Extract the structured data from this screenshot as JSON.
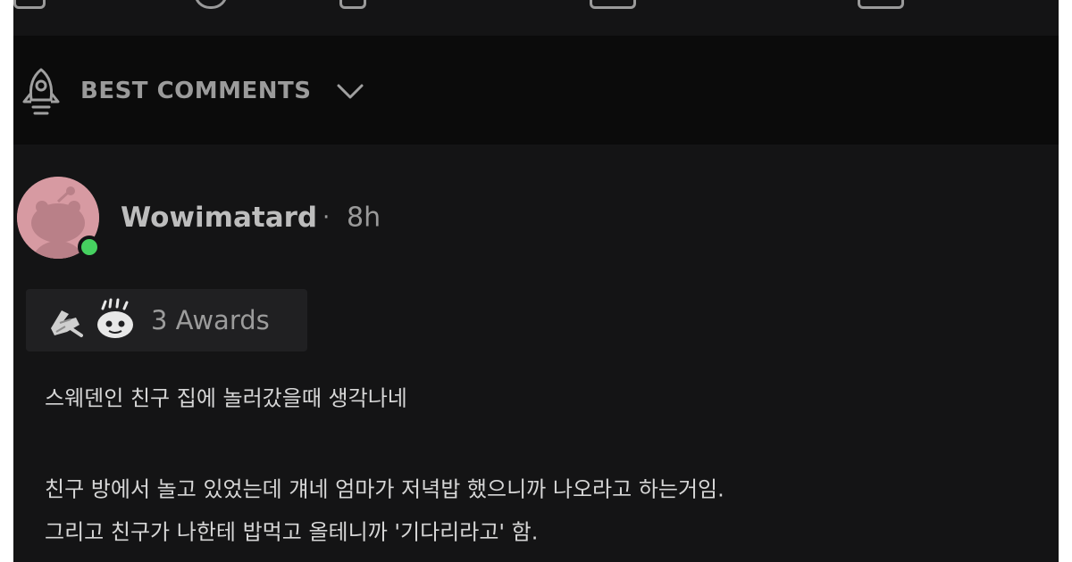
{
  "sort": {
    "label": "BEST COMMENTS"
  },
  "comment": {
    "username": "Wowimatard",
    "separator": "·",
    "time": "8h",
    "awards_label": "3 Awards",
    "body": [
      "스웨덴인 친구 집에 놀러갔을때 생각나네",
      "친구 방에서 놀고 있었는데 걔네 엄마가 저녁밥 했으니까 나오라고 하는거임.",
      "그리고 친구가 나한테 밥먹고 올테니까 '기다리라고' 함."
    ]
  },
  "icons": [
    "rocket-icon",
    "chevron-down-icon",
    "avatar-snoo",
    "online-status-icon",
    "award-icon",
    "award-icon"
  ],
  "colors": {
    "background": "#141415",
    "online": "#46d160",
    "avatar": "#d79aa2"
  }
}
